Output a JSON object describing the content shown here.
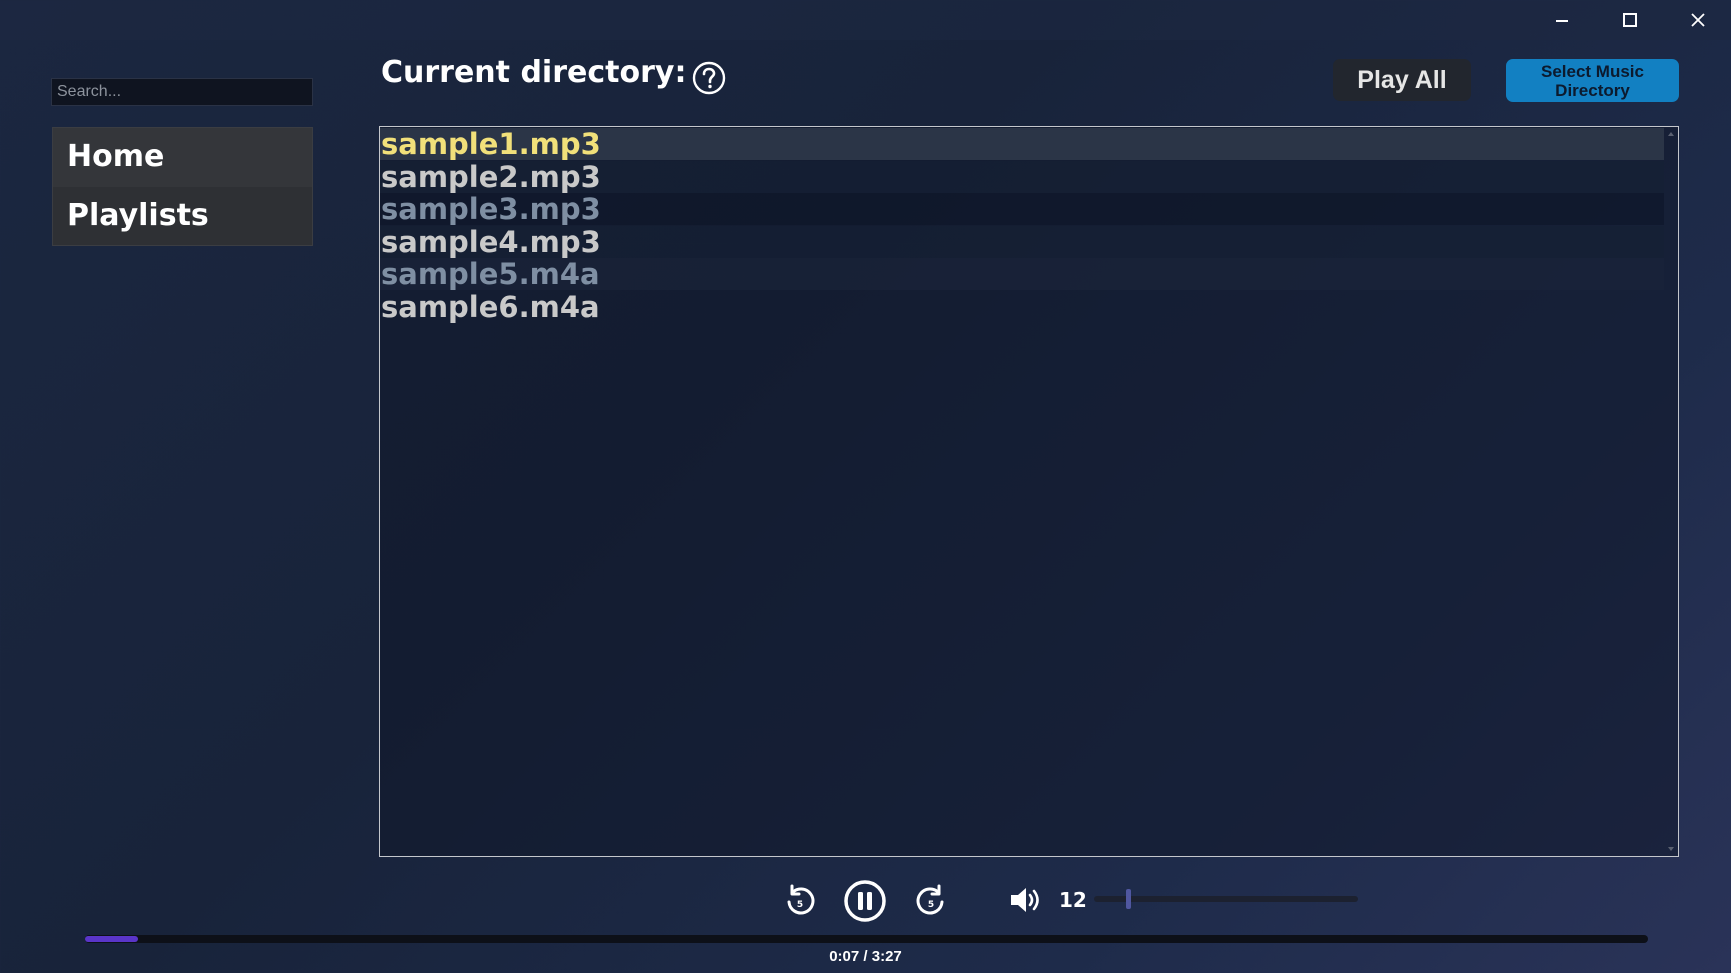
{
  "window": {
    "controls": [
      "minimize",
      "maximize",
      "close"
    ]
  },
  "sidebar": {
    "search_placeholder": "Search...",
    "items": [
      {
        "label": "Home"
      },
      {
        "label": "Playlists"
      }
    ]
  },
  "header": {
    "title": "Current directory:",
    "help_icon": "question-circle-icon",
    "play_all_label": "Play All",
    "select_dir_label": "Select Music\nDirectory"
  },
  "files": [
    {
      "name": "sample1.mp3",
      "color": "#f1e07a",
      "state": "playing"
    },
    {
      "name": "sample2.mp3",
      "color": "#c9c9c9",
      "state": "normal"
    },
    {
      "name": "sample3.mp3",
      "color": "#7f8fa3",
      "state": "normal"
    },
    {
      "name": "sample4.mp3",
      "color": "#c9c9c9",
      "state": "normal"
    },
    {
      "name": "sample5.m4a",
      "color": "#7f8fa3",
      "state": "normal"
    },
    {
      "name": "sample6.m4a",
      "color": "#c9c9c9",
      "state": "normal"
    }
  ],
  "player": {
    "rewind_icon": "rewind-5-icon",
    "pause_icon": "pause-circle-icon",
    "forward_icon": "forward-5-icon",
    "volume_icon": "speaker-icon",
    "volume": "12",
    "volume_fraction": 0.12,
    "progress_fraction": 0.034,
    "time": "0:07 / 3:27"
  },
  "colors": {
    "accent_blue": "#1280c2",
    "progress_purple": "#5a35c8",
    "playing_yellow": "#f1e07a"
  }
}
